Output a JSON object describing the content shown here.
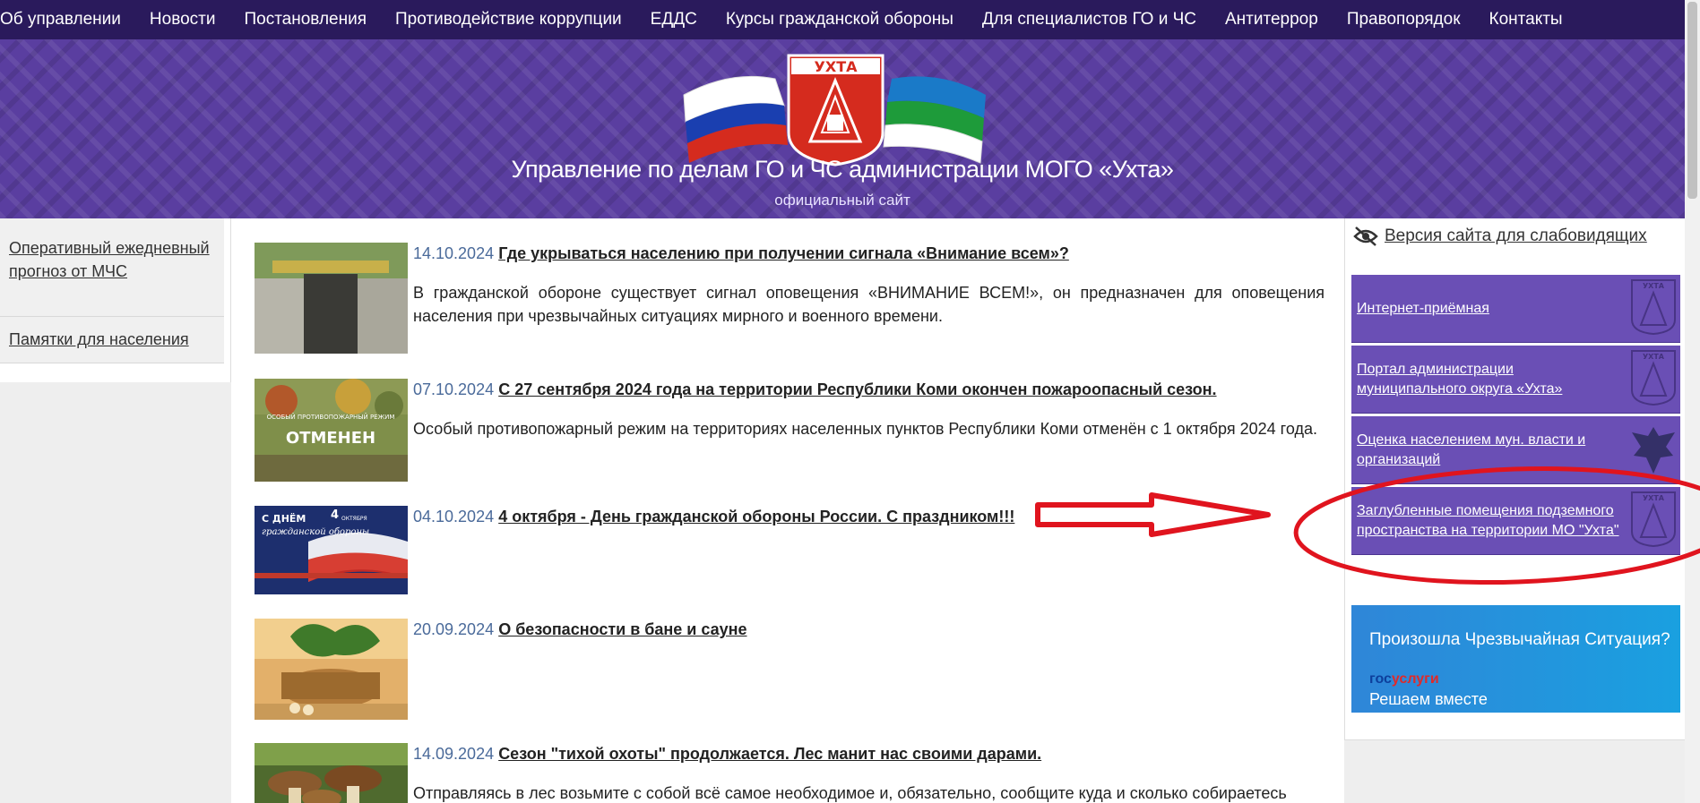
{
  "nav": {
    "items": [
      "Об управлении",
      "Новости",
      "Постановления",
      "Противодействие коррупции",
      "ЕДДС",
      "Курсы гражданской обороны",
      "Для специалистов ГО и ЧС",
      "Антитеррор",
      "Правопорядок",
      "Контакты"
    ]
  },
  "header": {
    "emblem_text": "УХТА",
    "title": "Управление по делам ГО и ЧС администрации МОГО «Ухта»",
    "subtitle": "официальный сайт"
  },
  "left_menu": {
    "items": [
      "Оперативный ежедневный прогноз от МЧС",
      "Памятки для населения"
    ]
  },
  "news": [
    {
      "date": "14.10.2024",
      "title": "Где укрываться населению при получении сигнала «Внимание всем»?",
      "excerpt": "В гражданской обороне существует сигнал оповещения «ВНИМАНИЕ ВСЕМ!», он предназначен для оповещения населения при чрезвычайных ситуациях мирного и военного времени."
    },
    {
      "date": "07.10.2024",
      "title": "С 27 сентября 2024 года на территории Республики Коми окончен пожароопасный сезон.",
      "excerpt": "Особый противопожарный режим на территориях населенных пунктов Республики Коми отменён с 1 октября 2024 года.",
      "thumb_top": "ОСОБЫЙ ПРОТИВОПОЖАРНЫЙ РЕЖИМ",
      "thumb_main": "ОТМЕНЕН"
    },
    {
      "date": "04.10.2024",
      "title": "4 октября - День гражданской обороны России. С праздником!!!",
      "excerpt": "",
      "thumb_l1": "С ДНЁМ",
      "thumb_l2": "4",
      "thumb_l3": "ОКТЯБРЯ",
      "thumb_l4": "гражданской обороны"
    },
    {
      "date": "20.09.2024",
      "title": "О безопасности в бане и сауне",
      "excerpt": ""
    },
    {
      "date": "14.09.2024",
      "title": "Сезон \"тихой охоты\" продолжается. Лес манит нас своими дарами.",
      "excerpt": "Отправляясь в лес возьмите с собой всё самое необходимое и, обязательно, сообщите куда и сколько собираетесь"
    }
  ],
  "right": {
    "vision_link": "Версия сайта для слабовидящих",
    "blocks": [
      "Интернет-приёмная",
      "Портал администрации муниципального округа «Ухта»",
      "Оценка населением мун. власти и организаций",
      "Заглубленные помещения подземного пространства на территории МО \"Ухта\""
    ],
    "logo_text": "УХТА",
    "banner": {
      "question": "Произошла Чрезвычайная Ситуация?",
      "gos": "гос",
      "uslugi": "услуги",
      "slogan": "Решаем вместе"
    }
  },
  "colors": {
    "nav_bg": "#2a1a5c",
    "header_bg": "#5a3ea0",
    "block_bg": "#6a4fb5",
    "annotation": "#e0141e"
  }
}
